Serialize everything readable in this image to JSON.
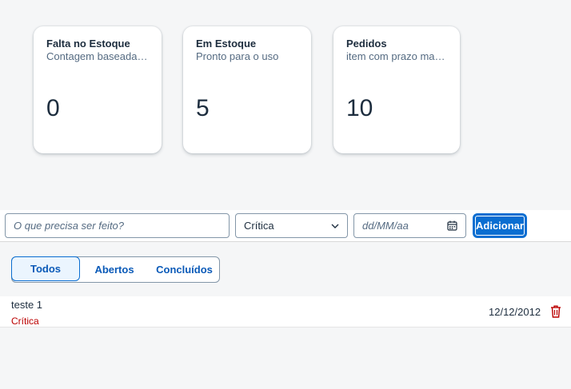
{
  "cards": [
    {
      "title": "Falta no Estoque",
      "subtitle": "Contagem baseada …",
      "value": "0"
    },
    {
      "title": "Em Estoque",
      "subtitle": "Pronto para o uso",
      "value": "5"
    },
    {
      "title": "Pedidos",
      "subtitle": "item com prazo mar…",
      "value": "10"
    }
  ],
  "toolbar": {
    "task_placeholder": "O que precisa ser feito?",
    "priority_value": "Crítica",
    "date_placeholder": "dd/MM/aa",
    "add_label": "Adicionar"
  },
  "filter": {
    "tabs": [
      "Todos",
      "Abertos",
      "Concluídos"
    ],
    "selected": "Todos"
  },
  "tasks": [
    {
      "name": "teste 1",
      "priority": "Crítica",
      "date": "12/12/2012"
    }
  ],
  "colors": {
    "accent": "#0a6ed1",
    "critical": "#bb0000"
  },
  "icons": {
    "priority_dropdown": "chevron-down-icon",
    "date_picker": "calendar-icon",
    "delete": "trash-icon"
  }
}
